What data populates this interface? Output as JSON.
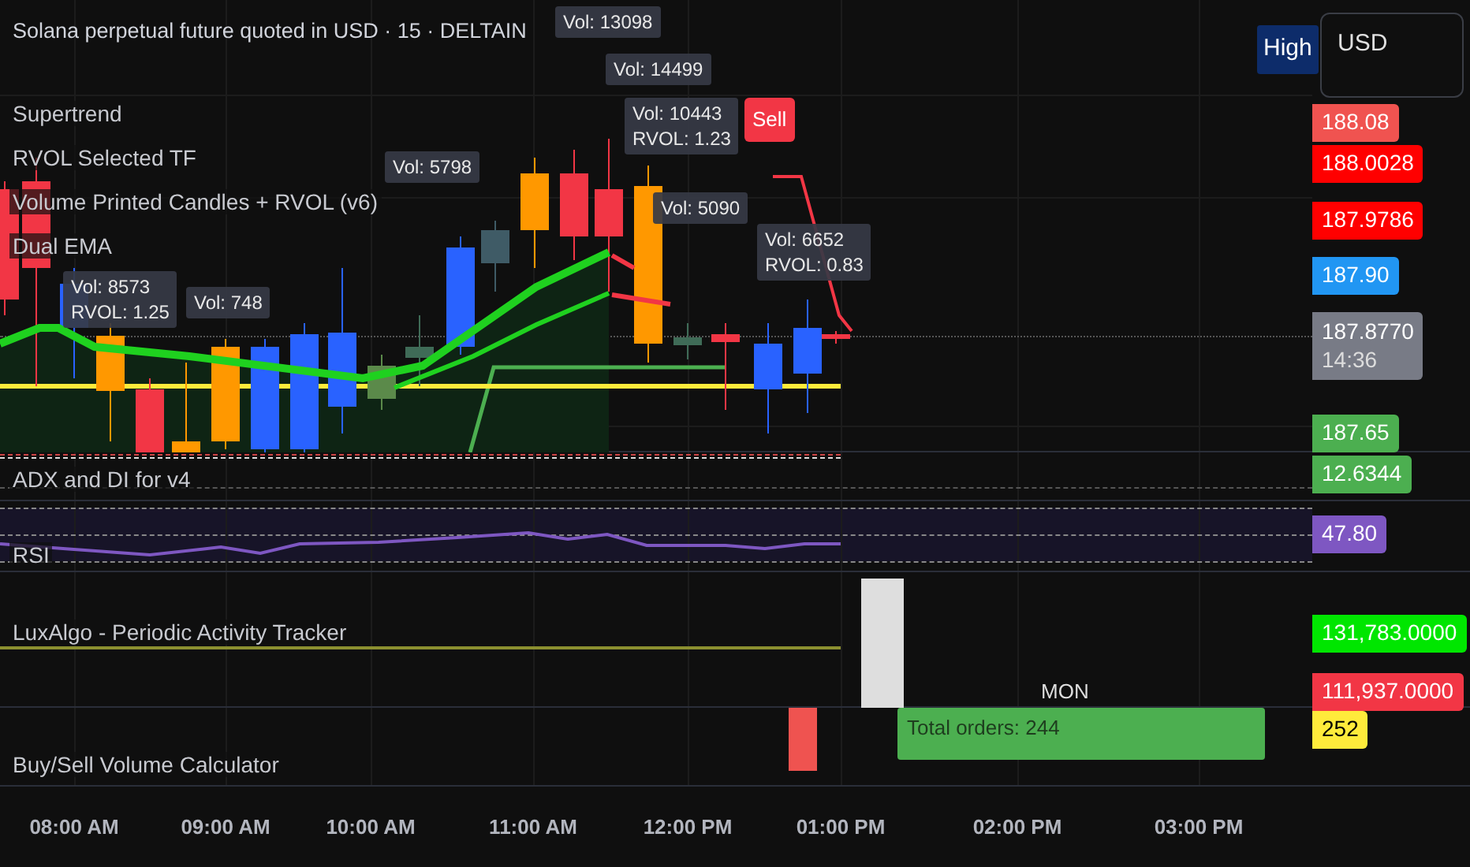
{
  "header": {
    "title": "Solana perpetual future quoted in USD · 15 · DELTAIN",
    "price_source": "High",
    "currency": "USD"
  },
  "main_pane": {
    "legends": [
      "Supertrend",
      "RVOL Selected TF",
      "Volume Printed Candles + RVOL (v6)",
      "Dual EMA"
    ],
    "volume_labels": [
      {
        "lines": [
          "Vol: 13098"
        ]
      },
      {
        "lines": [
          "Vol: 14499"
        ]
      },
      {
        "lines": [
          "Vol: 10443",
          "RVOL: 1.23"
        ]
      },
      {
        "lines": [
          "Vol: 5090"
        ]
      },
      {
        "lines": [
          "Vol: 6652",
          "RVOL: 0.83"
        ]
      },
      {
        "lines": [
          "Vol: 8573",
          "RVOL: 1.25"
        ]
      },
      {
        "lines": [
          "Vol: 5798"
        ]
      },
      {
        "lines": [
          "Vol: 748"
        ]
      }
    ],
    "signal_label": "Sell",
    "price_labels": [
      {
        "text": "188.08",
        "color": "#f05350"
      },
      {
        "text": "188.0028",
        "color": "#ff0000"
      },
      {
        "text": "187.9786",
        "color": "#ff0000"
      },
      {
        "text": "187.90",
        "color": "#2196f3"
      },
      {
        "text": "187.8770",
        "countdown": "14:36",
        "color": "#787b86"
      },
      {
        "text": "187.65",
        "color": "#4caf50"
      }
    ]
  },
  "adx_pane": {
    "legend": "ADX and DI for v4",
    "value_label": {
      "text": "12.6344",
      "color": "#4caf50"
    }
  },
  "rsi_pane": {
    "legend": "RSI",
    "value_label": {
      "text": "47.80",
      "color": "#7e57c2"
    }
  },
  "activity_pane": {
    "legend": "LuxAlgo - Periodic Activity Tracker",
    "day_label": "MON",
    "value_labels": [
      {
        "text": "131,783.0000",
        "color": "#00e600"
      },
      {
        "text": "111,937.0000",
        "color": "#f23645"
      }
    ]
  },
  "volume_pane": {
    "legend": "Buy/Sell Volume Calculator",
    "total_orders": "Total orders: 244",
    "value_label": {
      "text": "252",
      "color": "#ffeb3b"
    }
  },
  "time_axis": [
    "08:00 AM",
    "09:00 AM",
    "10:00 AM",
    "11:00 AM",
    "12:00 PM",
    "01:00 PM",
    "02:00 PM",
    "03:00 PM"
  ]
}
